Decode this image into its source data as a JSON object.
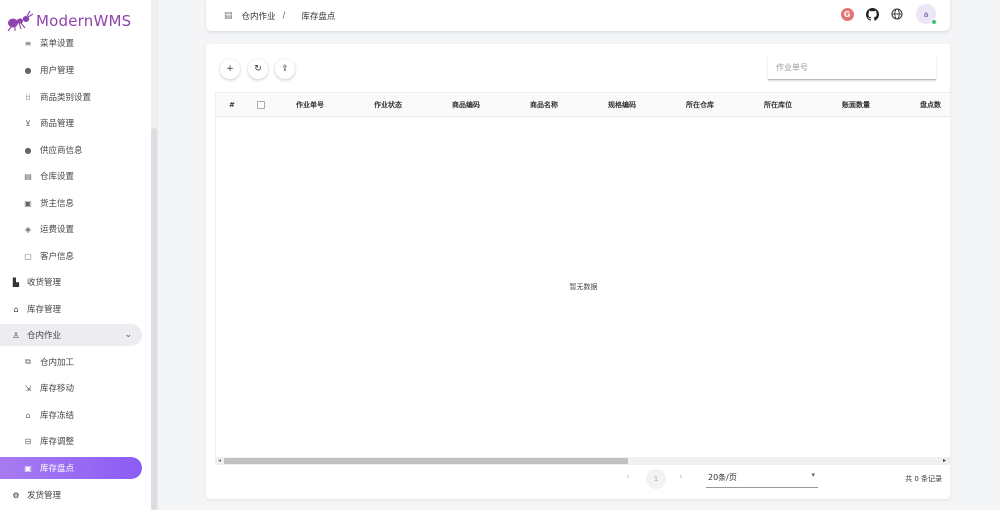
{
  "app": {
    "logo_text": "ModernWMS"
  },
  "sidebar": {
    "items": [
      {
        "label": "菜单设置",
        "icon": "menu-icon",
        "glyph": "≡"
      },
      {
        "label": "用户管理",
        "icon": "user-icon",
        "glyph": "●"
      },
      {
        "label": "商品类别设置",
        "icon": "category-icon",
        "glyph": "⁞⁞"
      },
      {
        "label": "商品管理",
        "icon": "cart-icon",
        "glyph": "⊻"
      },
      {
        "label": "供应商信息",
        "icon": "supplier-icon",
        "glyph": "●"
      },
      {
        "label": "仓库设置",
        "icon": "warehouse-icon",
        "glyph": "▤"
      },
      {
        "label": "货主信息",
        "icon": "owner-icon",
        "glyph": "▣"
      },
      {
        "label": "运费设置",
        "icon": "freight-icon",
        "glyph": "◈"
      },
      {
        "label": "客户信息",
        "icon": "customer-icon",
        "glyph": "▢"
      },
      {
        "label": "收货管理",
        "icon": "receiving-icon",
        "glyph": "▙"
      },
      {
        "label": "库存管理",
        "icon": "stock-icon",
        "glyph": "⌂"
      },
      {
        "label": "仓内作业",
        "icon": "worker-icon",
        "glyph": "♙"
      },
      {
        "label": "仓内加工",
        "icon": "processing-icon",
        "glyph": "⧉"
      },
      {
        "label": "库存移动",
        "icon": "move-icon",
        "glyph": "⇲"
      },
      {
        "label": "库存冻结",
        "icon": "freeze-icon",
        "glyph": "⌂"
      },
      {
        "label": "库存调整",
        "icon": "adjust-icon",
        "glyph": "⊟"
      },
      {
        "label": "库存盘点",
        "icon": "inventory-check-icon",
        "glyph": "▣"
      },
      {
        "label": "发货管理",
        "icon": "shipping-icon",
        "glyph": "⚙"
      }
    ]
  },
  "header": {
    "breadcrumb": [
      "仓内作业",
      "库存盘点"
    ],
    "breadcrumb_sep": "/",
    "avatar_letter": "a"
  },
  "toolbar": {
    "add_glyph": "+",
    "refresh_glyph": "↻",
    "export_glyph": "⇪",
    "search_placeholder": "作业单号"
  },
  "table": {
    "columns": [
      "#",
      "作业单号",
      "作业状态",
      "商品编码",
      "商品名称",
      "规格编码",
      "所在仓库",
      "所在库位",
      "账面数量",
      "盘点数"
    ],
    "empty_text": "暂无数据"
  },
  "pagination": {
    "current_page": "1",
    "page_size": "20条/页",
    "total_text": "共 0 条记录"
  },
  "colors": {
    "accent": "#8b5cf6",
    "logo": "#8e44ad"
  }
}
